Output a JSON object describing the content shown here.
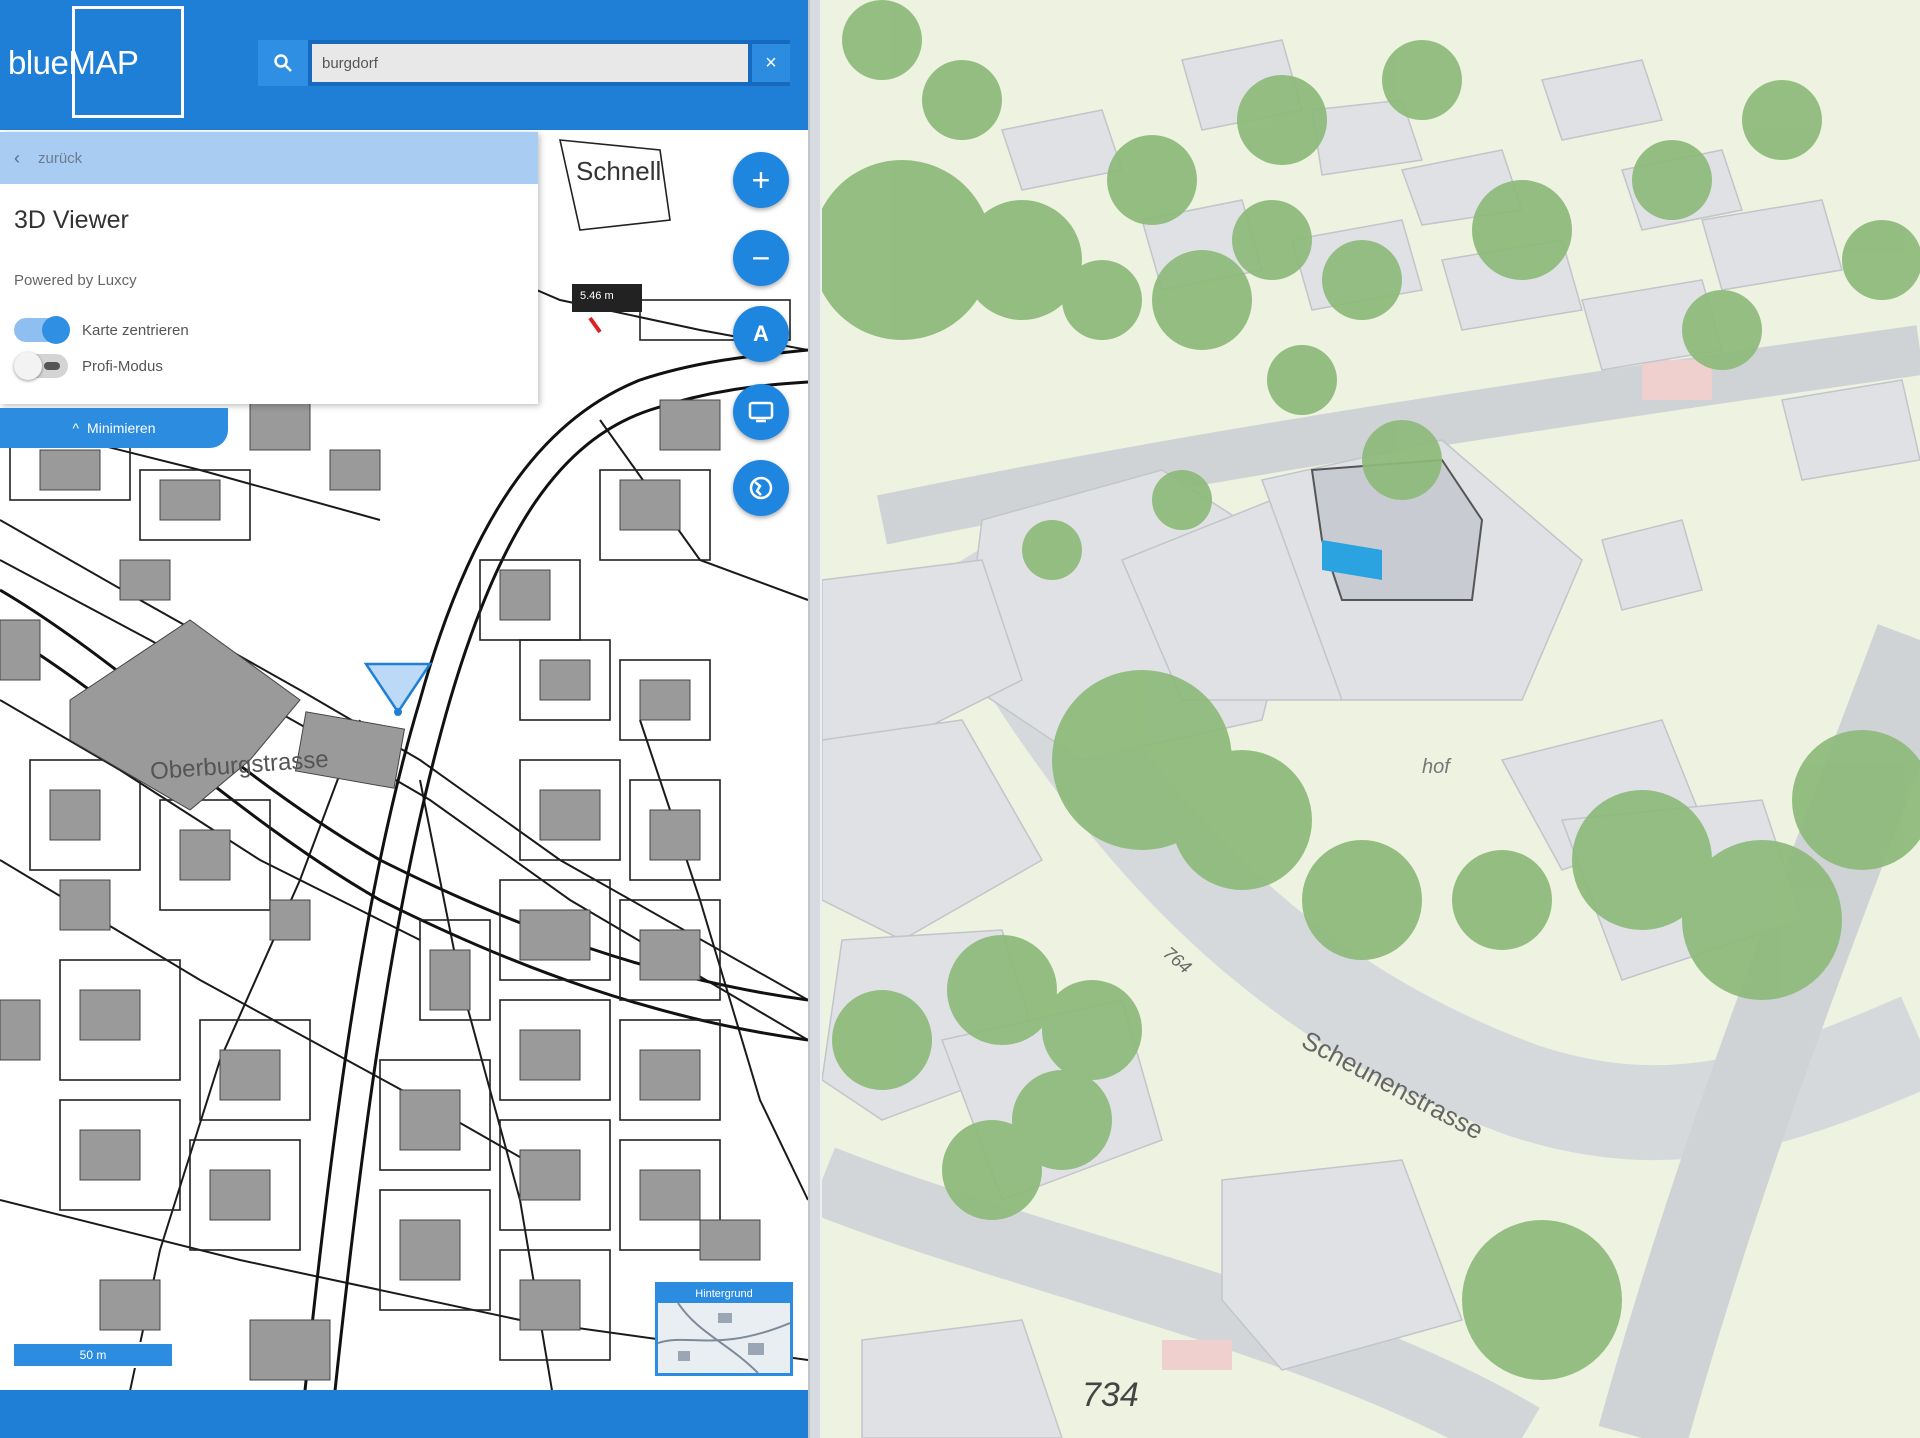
{
  "app": {
    "logo_text": "blueMAP"
  },
  "search": {
    "value": "burgdorf",
    "clear_label": "×"
  },
  "panel": {
    "back_label": "zurück",
    "title": "3D Viewer",
    "powered_by": "Powered by Luxcy",
    "toggle_sync_label": "Karte zentrieren",
    "toggle_sync_on": true,
    "toggle_profi_label": "Profi-Modus",
    "toggle_profi_on": false,
    "minimize_label": "Minimieren"
  },
  "map_controls": {
    "zoom_in": "+",
    "zoom_out": "−",
    "north": "A"
  },
  "map2d": {
    "street_label_1": "Schnell",
    "street_label_2": "Oberburgstrasse",
    "measure_label": "5.46 m",
    "scale_label": "50 m",
    "basemap_label": "Hintergrund"
  },
  "scene3d": {
    "street_label": "Scheunenstrasse",
    "parcel_number": "734",
    "label_764": "764",
    "label_hof": "hof"
  },
  "colors": {
    "brand_blue": "#1f7fd6",
    "light_blue": "#a9cdf2",
    "tree_green": "#8dba7a",
    "ground": "#eef2e0"
  }
}
